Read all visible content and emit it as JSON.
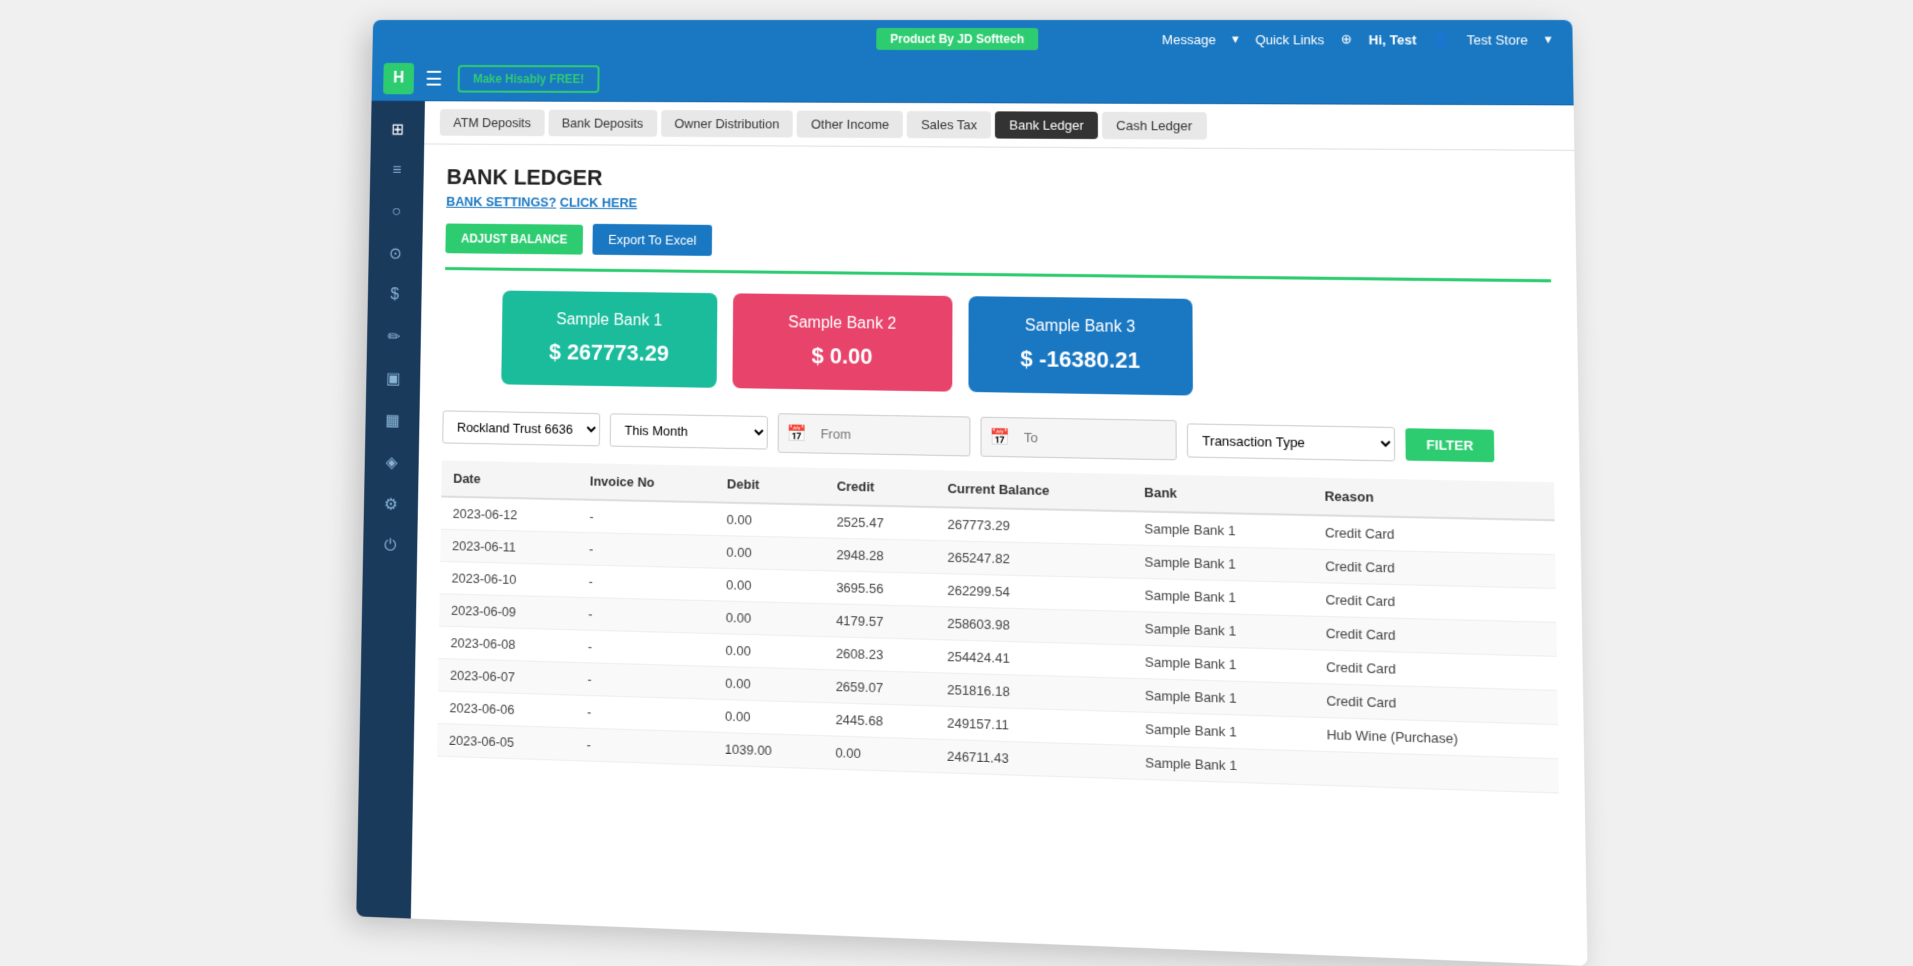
{
  "topbar": {
    "product_label": "Product By JD Softtech",
    "message": "Message",
    "quick_links": "Quick Links",
    "hi_user": "Hi, Test",
    "store": "Test Store"
  },
  "header": {
    "logo": "H",
    "make_free_label": "Make Hisably FREE!",
    "hamburger": "☰"
  },
  "sub_nav": {
    "tabs": [
      {
        "label": "ATM Deposits",
        "active": false
      },
      {
        "label": "Bank Deposits",
        "active": false
      },
      {
        "label": "Owner Distribution",
        "active": false
      },
      {
        "label": "Other Income",
        "active": false
      },
      {
        "label": "Sales Tax",
        "active": false
      },
      {
        "label": "Bank Ledger",
        "active": true
      },
      {
        "label": "Cash Ledger",
        "active": false
      }
    ]
  },
  "sidebar": {
    "icons": [
      {
        "name": "dashboard-icon",
        "symbol": "⊞"
      },
      {
        "name": "report-icon",
        "symbol": "📋"
      },
      {
        "name": "cash-icon",
        "symbol": "💰"
      },
      {
        "name": "cart-icon",
        "symbol": "🛒"
      },
      {
        "name": "dollar-icon",
        "symbol": "$"
      },
      {
        "name": "tag-icon",
        "symbol": "🏷"
      },
      {
        "name": "fuel-icon",
        "symbol": "⛽"
      },
      {
        "name": "chart-icon",
        "symbol": "📊"
      },
      {
        "name": "box-icon",
        "symbol": "📦"
      },
      {
        "name": "settings-icon",
        "symbol": "⚙"
      },
      {
        "name": "power-icon",
        "symbol": "⏻"
      }
    ]
  },
  "page": {
    "title": "BANK LEDGER",
    "bank_settings_text": "BANK SETTINGS?",
    "bank_settings_link": "CLICK HERE",
    "adjust_balance_btn": "ADJUST BALANCE",
    "export_excel_btn": "Export To Excel"
  },
  "bank_cards": [
    {
      "name": "Sample Bank 1",
      "amount": "$ 267773.29",
      "style": "teal"
    },
    {
      "name": "Sample Bank 2",
      "amount": "$ 0.00",
      "style": "red"
    },
    {
      "name": "Sample Bank 3",
      "amount": "$ -16380.21",
      "style": "blue"
    }
  ],
  "filters": {
    "bank_select_value": "Rockland Trust 6636",
    "period_select_value": "This Month",
    "from_placeholder": "From",
    "to_placeholder": "To",
    "transaction_type_placeholder": "Transaction Type",
    "filter_btn": "FILTER",
    "month_label": "Month",
    "from_label": "From"
  },
  "table": {
    "columns": [
      "Date",
      "Invoice No",
      "Debit",
      "Credit",
      "Current Balance",
      "Bank",
      "Reason"
    ],
    "rows": [
      {
        "date": "2023-06-12",
        "invoice": "-",
        "debit": "0.00",
        "credit": "2525.47",
        "balance": "267773.29",
        "bank": "Sample Bank 1",
        "reason": "Credit Card"
      },
      {
        "date": "2023-06-11",
        "invoice": "-",
        "debit": "0.00",
        "credit": "2948.28",
        "balance": "265247.82",
        "bank": "Sample Bank 1",
        "reason": "Credit Card"
      },
      {
        "date": "2023-06-10",
        "invoice": "-",
        "debit": "0.00",
        "credit": "3695.56",
        "balance": "262299.54",
        "bank": "Sample Bank 1",
        "reason": "Credit Card"
      },
      {
        "date": "2023-06-09",
        "invoice": "-",
        "debit": "0.00",
        "credit": "4179.57",
        "balance": "258603.98",
        "bank": "Sample Bank 1",
        "reason": "Credit Card"
      },
      {
        "date": "2023-06-08",
        "invoice": "-",
        "debit": "0.00",
        "credit": "2608.23",
        "balance": "254424.41",
        "bank": "Sample Bank 1",
        "reason": "Credit Card"
      },
      {
        "date": "2023-06-07",
        "invoice": "-",
        "debit": "0.00",
        "credit": "2659.07",
        "balance": "251816.18",
        "bank": "Sample Bank 1",
        "reason": "Credit Card"
      },
      {
        "date": "2023-06-06",
        "invoice": "-",
        "debit": "0.00",
        "credit": "2445.68",
        "balance": "249157.11",
        "bank": "Sample Bank 1",
        "reason": "Hub Wine (Purchase)"
      },
      {
        "date": "2023-06-05",
        "invoice": "-",
        "debit": "1039.00",
        "credit": "0.00",
        "balance": "246711.43",
        "bank": "Sample Bank 1",
        "reason": ""
      }
    ]
  }
}
